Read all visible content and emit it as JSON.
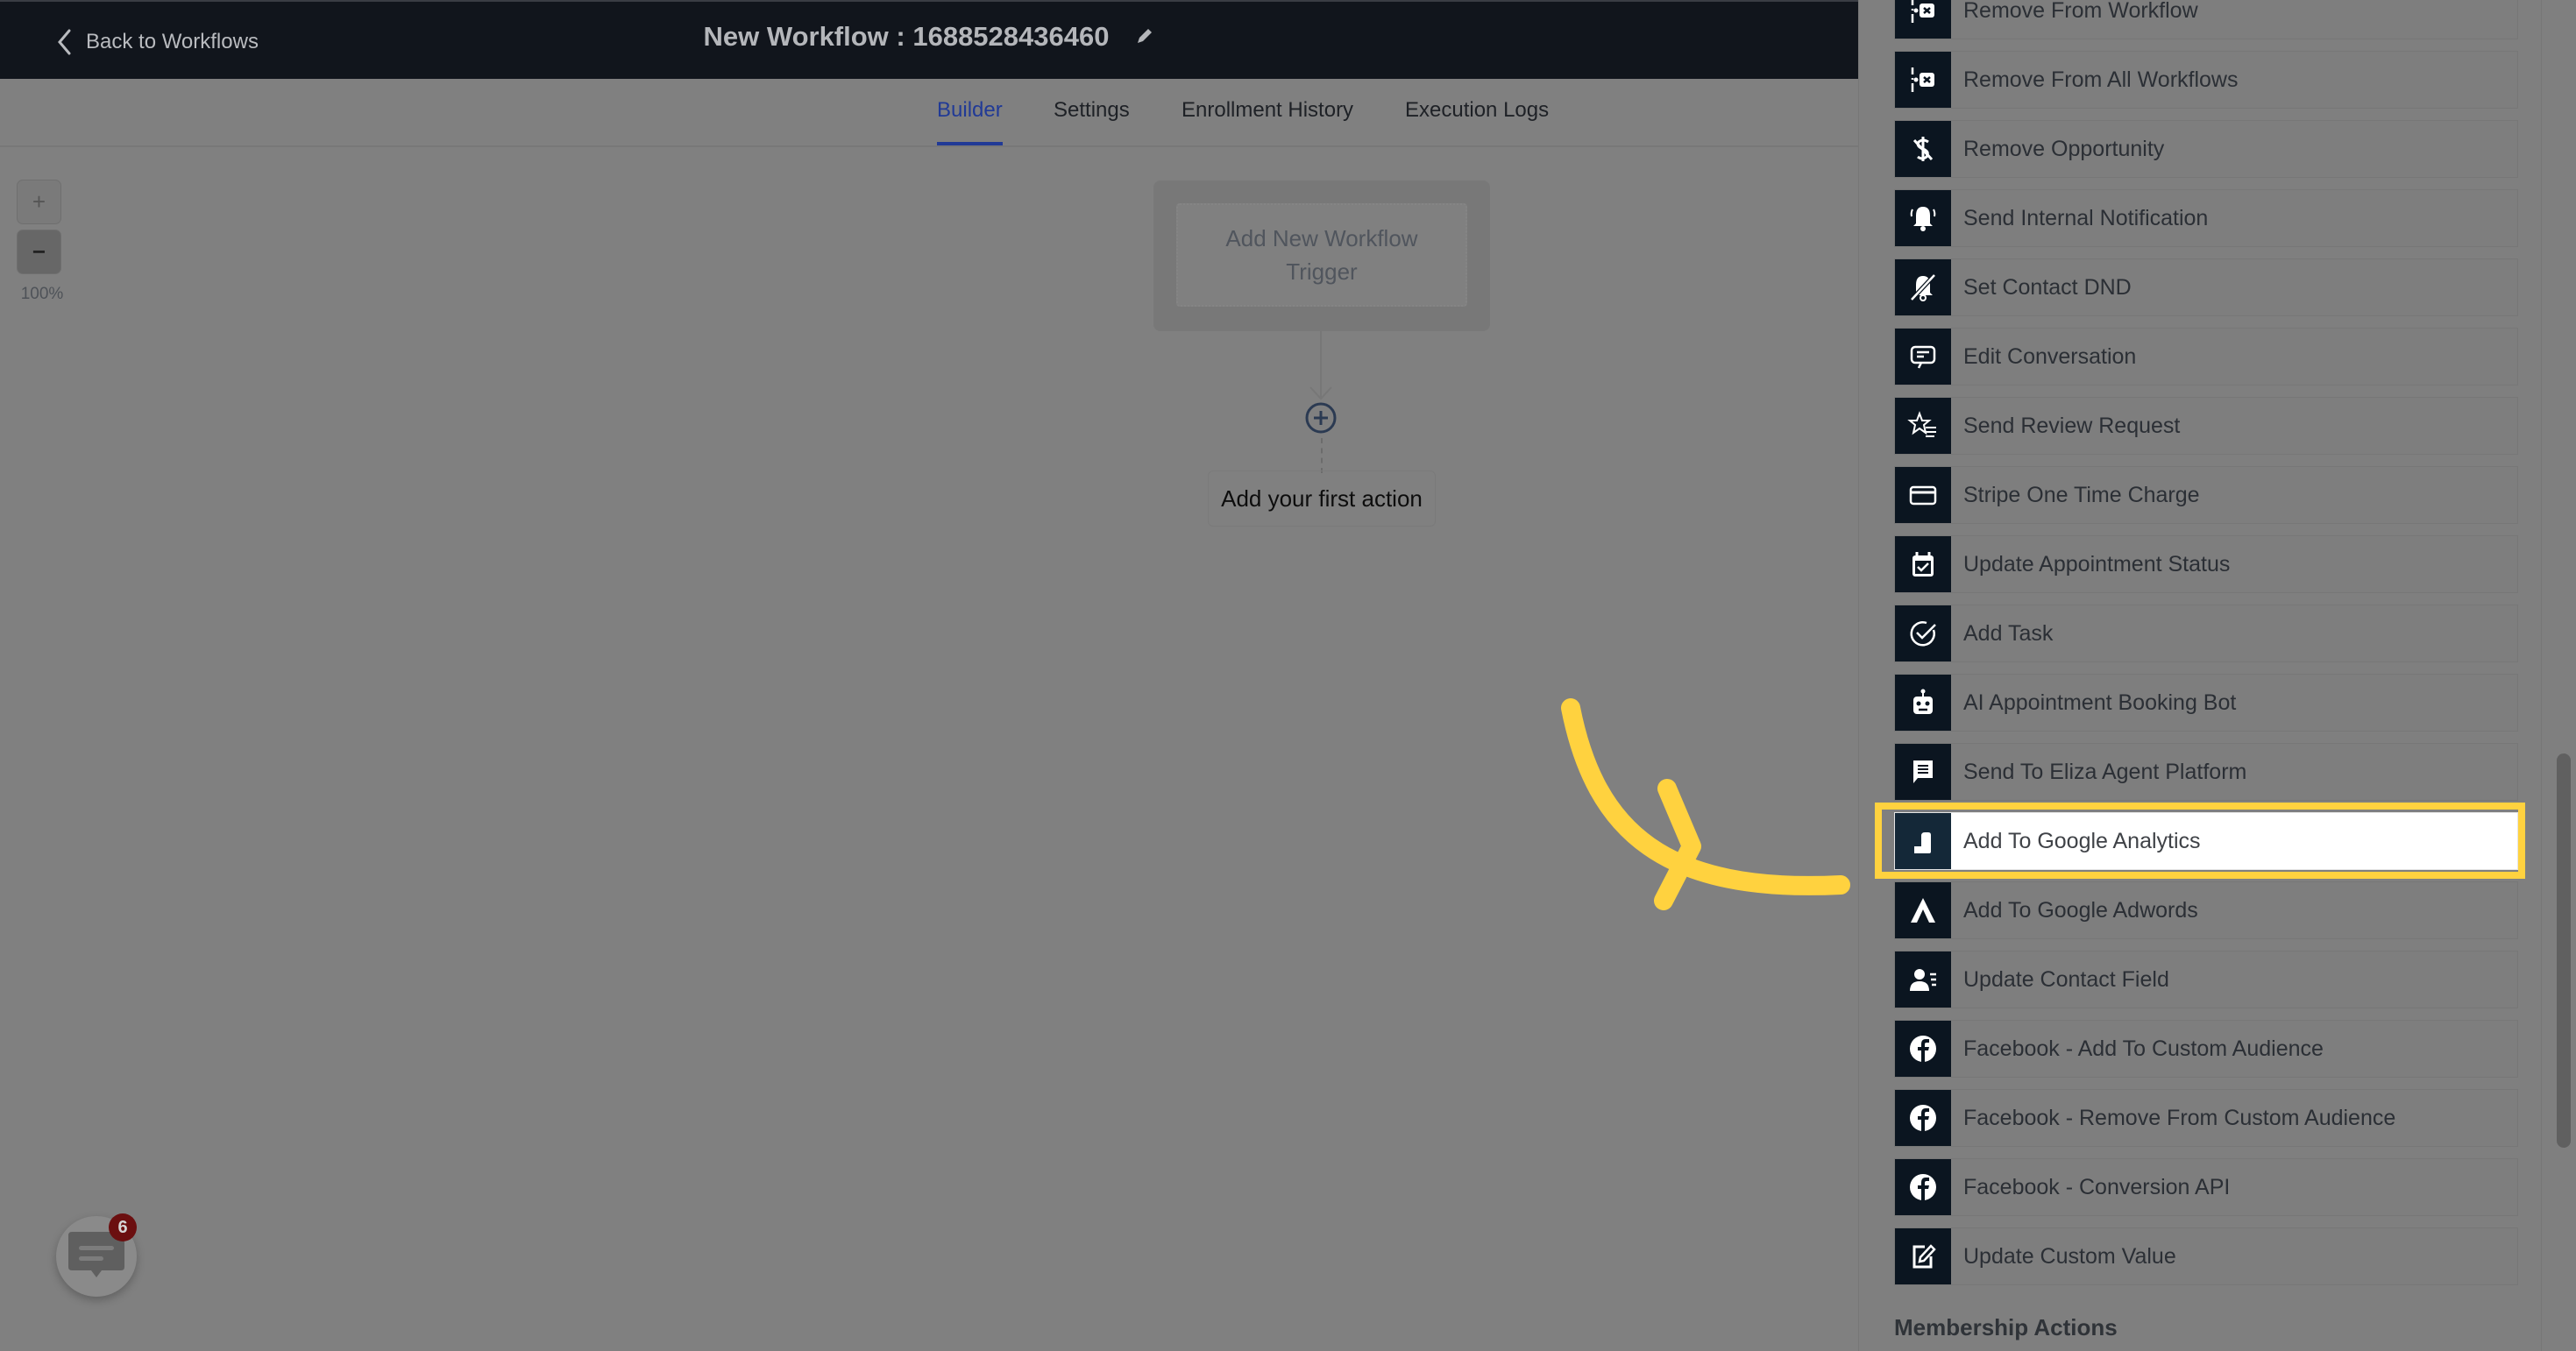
{
  "header": {
    "back_label": "Back to Workflows",
    "title": "New Workflow : 1688528436460"
  },
  "tabs": [
    {
      "label": "Builder",
      "active": true
    },
    {
      "label": "Settings",
      "active": false
    },
    {
      "label": "Enrollment History",
      "active": false
    },
    {
      "label": "Execution Logs",
      "active": false
    }
  ],
  "zoom": {
    "plus": "+",
    "minus": "−",
    "level": "100%"
  },
  "canvas": {
    "trigger_label": "Add New Workflow Trigger",
    "first_action_label": "Add your first action"
  },
  "chat": {
    "badge_count": "6"
  },
  "panel": {
    "items": [
      {
        "label": "Remove From Workflow",
        "icon": "remove-workflow-icon"
      },
      {
        "label": "Remove From All Workflows",
        "icon": "remove-workflow-icon"
      },
      {
        "label": "Remove Opportunity",
        "icon": "dollar-slash-icon"
      },
      {
        "label": "Send Internal Notification",
        "icon": "bell-icon"
      },
      {
        "label": "Set Contact DND",
        "icon": "bell-off-icon"
      },
      {
        "label": "Edit Conversation",
        "icon": "message-icon"
      },
      {
        "label": "Send Review Request",
        "icon": "star-list-icon"
      },
      {
        "label": "Stripe One Time Charge",
        "icon": "credit-card-icon"
      },
      {
        "label": "Update Appointment Status",
        "icon": "calendar-check-icon"
      },
      {
        "label": "Add Task",
        "icon": "circle-check-icon"
      },
      {
        "label": "AI Appointment Booking Bot",
        "icon": "robot-icon"
      },
      {
        "label": "Send To Eliza Agent Platform",
        "icon": "chat-bubble-icon"
      },
      {
        "label": "Add To Google Analytics",
        "icon": "analytics-icon",
        "highlighted": true
      },
      {
        "label": "Add To Google Adwords",
        "icon": "adwords-icon"
      },
      {
        "label": "Update Contact Field",
        "icon": "user-list-icon"
      },
      {
        "label": "Facebook - Add To Custom Audience",
        "icon": "facebook-icon"
      },
      {
        "label": "Facebook - Remove From Custom Audience",
        "icon": "facebook-icon"
      },
      {
        "label": "Facebook - Conversion API",
        "icon": "facebook-icon"
      },
      {
        "label": "Update Custom Value",
        "icon": "edit-square-icon"
      }
    ],
    "section_heading": "Membership Actions"
  },
  "colors": {
    "highlight": "#ffd23f",
    "tab_active": "#213a96",
    "header_bg": "#11151c",
    "icon_bg": "#0b1520",
    "badge": "#6b0f10"
  }
}
